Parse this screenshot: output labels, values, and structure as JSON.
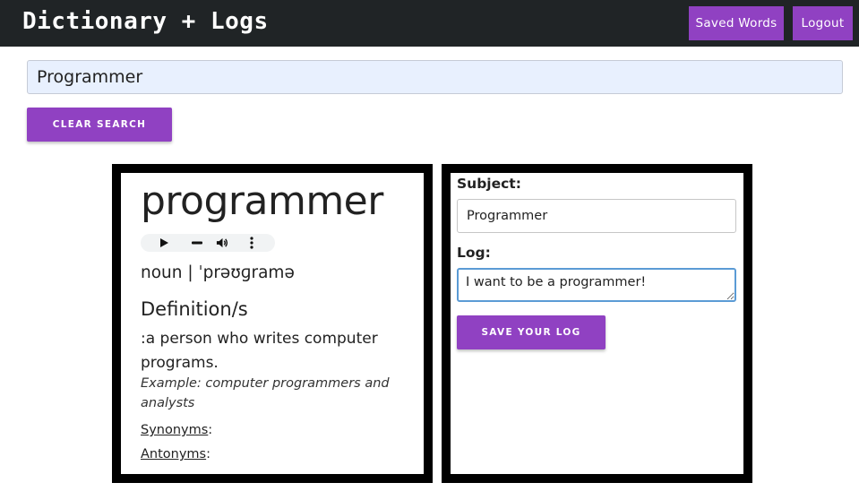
{
  "header": {
    "title": "Dictionary + Logs",
    "saved_words_label": "Saved Words",
    "logout_label": "Logout"
  },
  "search": {
    "value": "Programmer",
    "clear_label": "CLEAR SEARCH"
  },
  "definition": {
    "word": "programmer",
    "audio_player": {
      "icons": [
        "play-icon",
        "progress-icon",
        "volume-icon",
        "more-options-icon"
      ]
    },
    "part_of_speech": "noun",
    "separator": " | ",
    "pronunciation": "ˈprəʊɡramə",
    "definitions_heading": "Definition/s",
    "definition_text": ":a person who writes computer programs.",
    "example": "Example: computer programmers and analysts",
    "synonyms_label": "Synonyms",
    "synonyms_suffix": ":",
    "antonyms_label": "Antonyms",
    "antonyms_suffix": ":"
  },
  "log_form": {
    "subject_label": "Subject:",
    "subject_value": "Programmer",
    "log_label": "Log:",
    "log_value": "I want to be a programmer!",
    "save_label": "SAVE YOUR LOG"
  },
  "colors": {
    "accent": "#9041c2",
    "topbar": "#202426",
    "search_bg": "#e8f0fe"
  }
}
